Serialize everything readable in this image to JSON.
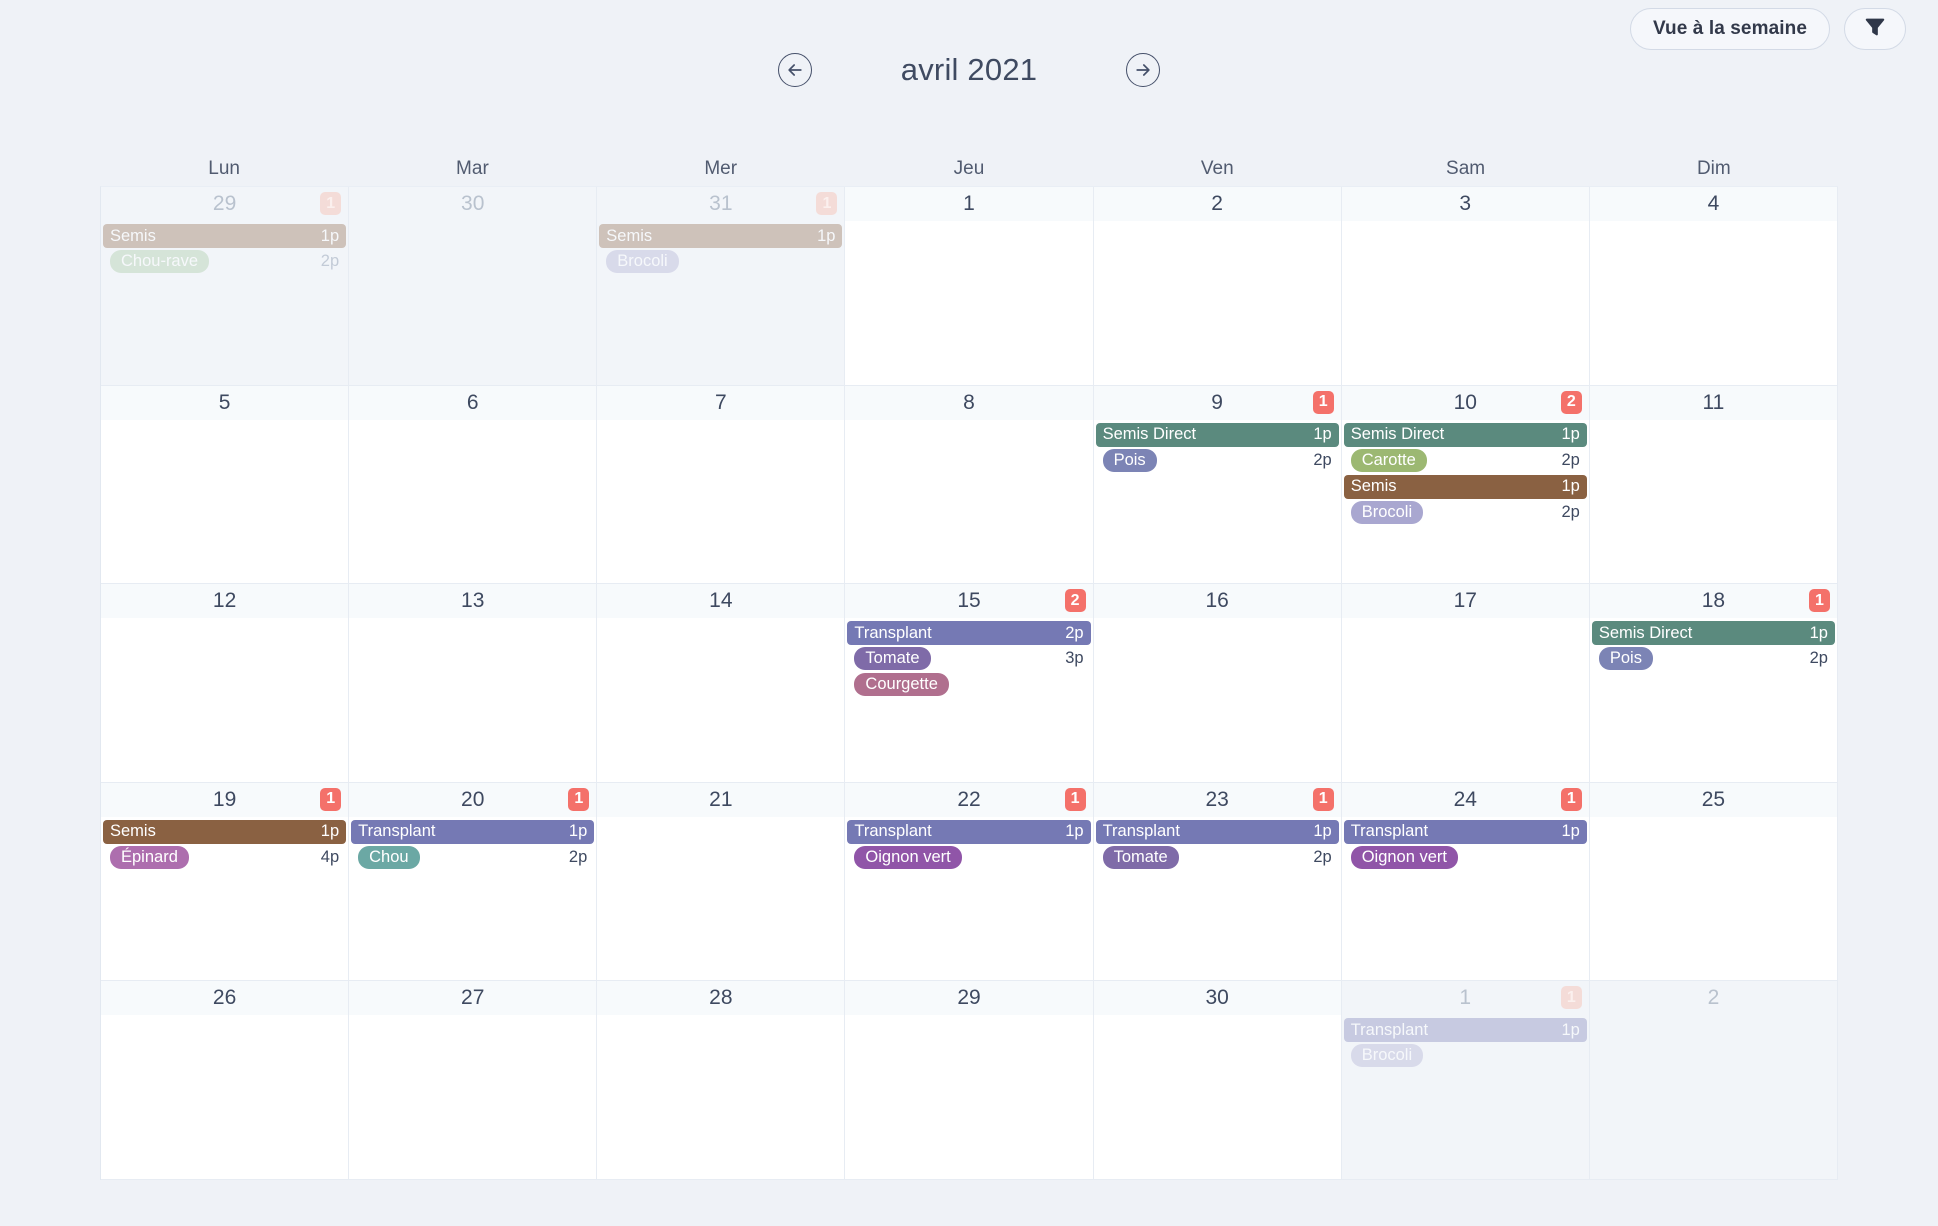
{
  "toolbar": {
    "week_view_label": "Vue à la semaine",
    "filter_icon": "filter-icon"
  },
  "header": {
    "prev_icon": "arrow-left-circle-icon",
    "next_icon": "arrow-right-circle-icon",
    "month_title": "avril 2021"
  },
  "weekdays": [
    "Lun",
    "Mar",
    "Mer",
    "Jeu",
    "Ven",
    "Sam",
    "Dim"
  ],
  "colors": {
    "semis": "#8a6142",
    "semis_direct": "#5b8a7e",
    "transplant": "#7579b4",
    "badge": "#f4716a",
    "chip_chou_rave": "#9fc49a",
    "chip_brocoli": "#a9a7d0",
    "chip_pois": "#7c84b5",
    "chip_carotte": "#9cb872",
    "chip_tomate": "#7f6ba8",
    "chip_courgette": "#b06f8e",
    "chip_epinard": "#ad6eae",
    "chip_chou": "#6ba8a4",
    "chip_oignon_vert": "#9055a8",
    "page_bg": "#eff2f7",
    "cell_bg": "#ffffff",
    "cell_out_bg": "#f2f5f9"
  },
  "weeks": [
    [
      {
        "day": "29",
        "out": true,
        "badge": "1",
        "groups": [
          {
            "bar": {
              "label": "Semis",
              "qty": "1p",
              "color": "#8a6142"
            },
            "subs": [
              {
                "chip": "Chou-rave",
                "chip_color": "#9fc49a",
                "qty": "2p"
              }
            ]
          }
        ]
      },
      {
        "day": "30",
        "out": true,
        "badge": null,
        "groups": []
      },
      {
        "day": "31",
        "out": true,
        "badge": "1",
        "groups": [
          {
            "bar": {
              "label": "Semis",
              "qty": "1p",
              "color": "#8a6142"
            },
            "subs": [
              {
                "chip": "Brocoli",
                "chip_color": "#a9a7d0",
                "qty": ""
              }
            ]
          }
        ]
      },
      {
        "day": "1",
        "out": false,
        "badge": null,
        "groups": []
      },
      {
        "day": "2",
        "out": false,
        "badge": null,
        "groups": []
      },
      {
        "day": "3",
        "out": false,
        "badge": null,
        "groups": []
      },
      {
        "day": "4",
        "out": false,
        "badge": null,
        "groups": []
      }
    ],
    [
      {
        "day": "5",
        "out": false,
        "badge": null,
        "groups": []
      },
      {
        "day": "6",
        "out": false,
        "badge": null,
        "groups": []
      },
      {
        "day": "7",
        "out": false,
        "badge": null,
        "groups": []
      },
      {
        "day": "8",
        "out": false,
        "badge": null,
        "groups": []
      },
      {
        "day": "9",
        "out": false,
        "badge": "1",
        "groups": [
          {
            "bar": {
              "label": "Semis Direct",
              "qty": "1p",
              "color": "#5b8a7e"
            },
            "subs": [
              {
                "chip": "Pois",
                "chip_color": "#7c84b5",
                "qty": "2p"
              }
            ]
          }
        ]
      },
      {
        "day": "10",
        "out": false,
        "badge": "2",
        "groups": [
          {
            "bar": {
              "label": "Semis Direct",
              "qty": "1p",
              "color": "#5b8a7e"
            },
            "subs": [
              {
                "chip": "Carotte",
                "chip_color": "#9cb872",
                "qty": "2p"
              }
            ]
          },
          {
            "bar": {
              "label": "Semis",
              "qty": "1p",
              "color": "#8a6142"
            },
            "subs": [
              {
                "chip": "Brocoli",
                "chip_color": "#a9a7d0",
                "qty": "2p"
              }
            ]
          }
        ]
      },
      {
        "day": "11",
        "out": false,
        "badge": null,
        "groups": []
      }
    ],
    [
      {
        "day": "12",
        "out": false,
        "badge": null,
        "groups": []
      },
      {
        "day": "13",
        "out": false,
        "badge": null,
        "groups": []
      },
      {
        "day": "14",
        "out": false,
        "badge": null,
        "groups": []
      },
      {
        "day": "15",
        "out": false,
        "badge": "2",
        "groups": [
          {
            "bar": {
              "label": "Transplant",
              "qty": "2p",
              "color": "#7579b4"
            },
            "subs": [
              {
                "chip": "Tomate",
                "chip_color": "#7f6ba8",
                "qty": "3p"
              },
              {
                "chip": "Courgette",
                "chip_color": "#b06f8e",
                "qty": ""
              }
            ]
          }
        ]
      },
      {
        "day": "16",
        "out": false,
        "badge": null,
        "groups": []
      },
      {
        "day": "17",
        "out": false,
        "badge": null,
        "groups": []
      },
      {
        "day": "18",
        "out": false,
        "badge": "1",
        "groups": [
          {
            "bar": {
              "label": "Semis Direct",
              "qty": "1p",
              "color": "#5b8a7e"
            },
            "subs": [
              {
                "chip": "Pois",
                "chip_color": "#7c84b5",
                "qty": "2p"
              }
            ]
          }
        ]
      }
    ],
    [
      {
        "day": "19",
        "out": false,
        "badge": "1",
        "groups": [
          {
            "bar": {
              "label": "Semis",
              "qty": "1p",
              "color": "#8a6142"
            },
            "subs": [
              {
                "chip": "Épinard",
                "chip_color": "#ad6eae",
                "qty": "4p"
              }
            ]
          }
        ]
      },
      {
        "day": "20",
        "out": false,
        "badge": "1",
        "groups": [
          {
            "bar": {
              "label": "Transplant",
              "qty": "1p",
              "color": "#7579b4"
            },
            "subs": [
              {
                "chip": "Chou",
                "chip_color": "#6ba8a4",
                "qty": "2p"
              }
            ]
          }
        ]
      },
      {
        "day": "21",
        "out": false,
        "badge": null,
        "groups": []
      },
      {
        "day": "22",
        "out": false,
        "badge": "1",
        "groups": [
          {
            "bar": {
              "label": "Transplant",
              "qty": "1p",
              "color": "#7579b4"
            },
            "subs": [
              {
                "chip": "Oignon vert",
                "chip_color": "#9055a8",
                "qty": ""
              }
            ]
          }
        ]
      },
      {
        "day": "23",
        "out": false,
        "badge": "1",
        "groups": [
          {
            "bar": {
              "label": "Transplant",
              "qty": "1p",
              "color": "#7579b4"
            },
            "subs": [
              {
                "chip": "Tomate",
                "chip_color": "#7f6ba8",
                "qty": "2p"
              }
            ]
          }
        ]
      },
      {
        "day": "24",
        "out": false,
        "badge": "1",
        "groups": [
          {
            "bar": {
              "label": "Transplant",
              "qty": "1p",
              "color": "#7579b4"
            },
            "subs": [
              {
                "chip": "Oignon vert",
                "chip_color": "#9055a8",
                "qty": ""
              }
            ]
          }
        ]
      },
      {
        "day": "25",
        "out": false,
        "badge": null,
        "groups": []
      }
    ],
    [
      {
        "day": "26",
        "out": false,
        "badge": null,
        "groups": []
      },
      {
        "day": "27",
        "out": false,
        "badge": null,
        "groups": []
      },
      {
        "day": "28",
        "out": false,
        "badge": null,
        "groups": []
      },
      {
        "day": "29",
        "out": false,
        "badge": null,
        "groups": []
      },
      {
        "day": "30",
        "out": false,
        "badge": null,
        "groups": []
      },
      {
        "day": "1",
        "out": true,
        "badge": "1",
        "groups": [
          {
            "bar": {
              "label": "Transplant",
              "qty": "1p",
              "color": "#7579b4"
            },
            "subs": [
              {
                "chip": "Brocoli",
                "chip_color": "#a9a7d0",
                "qty": ""
              }
            ]
          }
        ]
      },
      {
        "day": "2",
        "out": true,
        "badge": null,
        "groups": []
      }
    ]
  ]
}
